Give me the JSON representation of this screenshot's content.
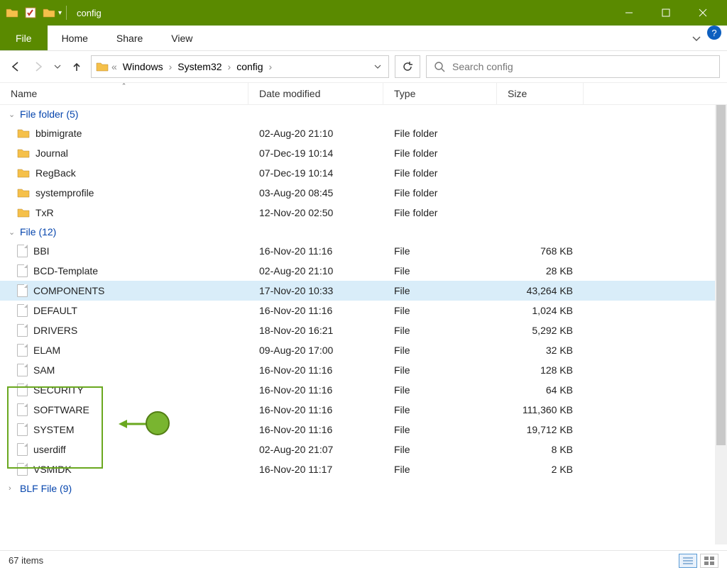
{
  "window": {
    "title": "config"
  },
  "ribbon": {
    "file": "File",
    "tabs": [
      "Home",
      "Share",
      "View"
    ]
  },
  "breadcrumbs": [
    "Windows",
    "System32",
    "config"
  ],
  "search": {
    "placeholder": "Search config"
  },
  "columns": {
    "name": "Name",
    "date": "Date modified",
    "type": "Type",
    "size": "Size"
  },
  "groups": [
    {
      "label": "File folder (5)",
      "open": true,
      "kind": "folder",
      "rows": [
        {
          "name": "bbimigrate",
          "date": "02-Aug-20 21:10",
          "type": "File folder",
          "size": ""
        },
        {
          "name": "Journal",
          "date": "07-Dec-19 10:14",
          "type": "File folder",
          "size": ""
        },
        {
          "name": "RegBack",
          "date": "07-Dec-19 10:14",
          "type": "File folder",
          "size": ""
        },
        {
          "name": "systemprofile",
          "date": "03-Aug-20 08:45",
          "type": "File folder",
          "size": ""
        },
        {
          "name": "TxR",
          "date": "12-Nov-20 02:50",
          "type": "File folder",
          "size": ""
        }
      ]
    },
    {
      "label": "File (12)",
      "open": true,
      "kind": "file",
      "rows": [
        {
          "name": "BBI",
          "date": "16-Nov-20 11:16",
          "type": "File",
          "size": "768 KB"
        },
        {
          "name": "BCD-Template",
          "date": "02-Aug-20 21:10",
          "type": "File",
          "size": "28 KB"
        },
        {
          "name": "COMPONENTS",
          "date": "17-Nov-20 10:33",
          "type": "File",
          "size": "43,264 KB",
          "selected": true
        },
        {
          "name": "DEFAULT",
          "date": "16-Nov-20 11:16",
          "type": "File",
          "size": "1,024 KB"
        },
        {
          "name": "DRIVERS",
          "date": "18-Nov-20 16:21",
          "type": "File",
          "size": "5,292 KB"
        },
        {
          "name": "ELAM",
          "date": "09-Aug-20 17:00",
          "type": "File",
          "size": "32 KB"
        },
        {
          "name": "SAM",
          "date": "16-Nov-20 11:16",
          "type": "File",
          "size": "128 KB"
        },
        {
          "name": "SECURITY",
          "date": "16-Nov-20 11:16",
          "type": "File",
          "size": "64 KB"
        },
        {
          "name": "SOFTWARE",
          "date": "16-Nov-20 11:16",
          "type": "File",
          "size": "111,360 KB"
        },
        {
          "name": "SYSTEM",
          "date": "16-Nov-20 11:16",
          "type": "File",
          "size": "19,712 KB"
        },
        {
          "name": "userdiff",
          "date": "02-Aug-20 21:07",
          "type": "File",
          "size": "8 KB"
        },
        {
          "name": "VSMIDK",
          "date": "16-Nov-20 11:17",
          "type": "File",
          "size": "2 KB"
        }
      ]
    },
    {
      "label": "BLF File (9)",
      "open": false,
      "kind": "file",
      "rows": []
    }
  ],
  "status": {
    "count": "67 items"
  },
  "annotation": {
    "highlight_rows": [
      "SAM",
      "SECURITY",
      "SOFTWARE",
      "SYSTEM"
    ]
  }
}
